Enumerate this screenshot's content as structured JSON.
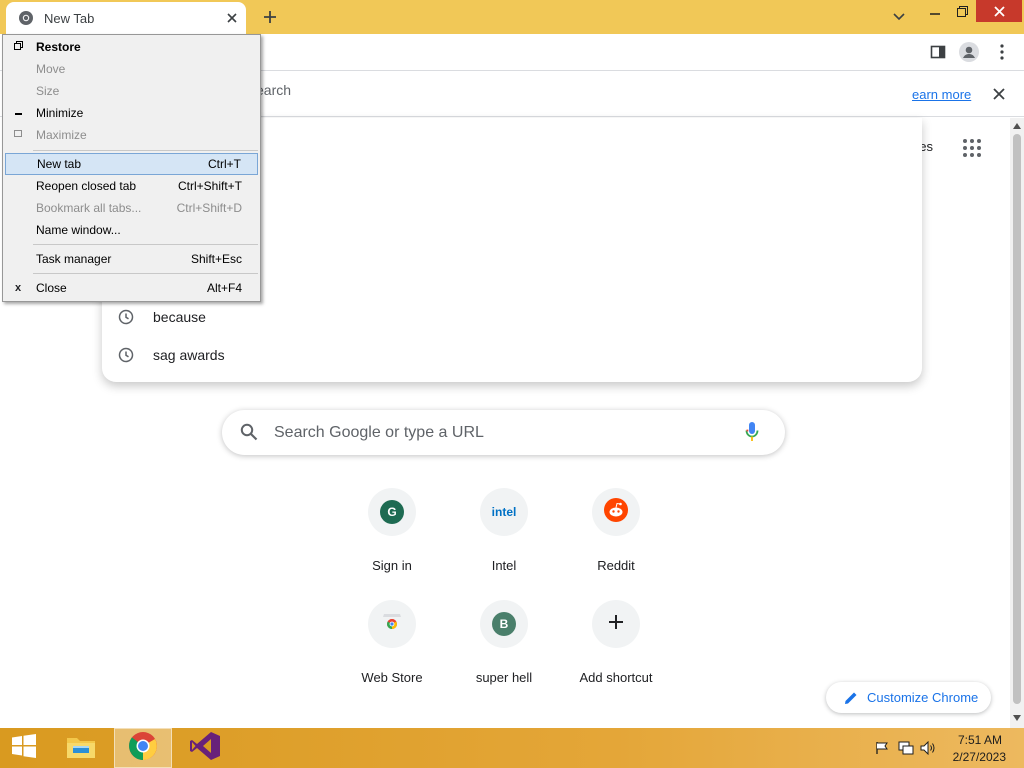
{
  "window": {
    "tab_title": "New Tab"
  },
  "infobar": {
    "text_fragment": "earch",
    "learn_more": "earn more"
  },
  "header": {
    "images_fragment": "ges"
  },
  "suggestions": [
    {
      "text": "because"
    },
    {
      "text": "sag awards"
    }
  ],
  "search": {
    "placeholder": "Search Google or type a URL"
  },
  "shortcuts": [
    {
      "label": "Sign in",
      "badge": "G",
      "color": "#1e6b52"
    },
    {
      "label": "Intel",
      "badge": "intel",
      "color": "#0071c5"
    },
    {
      "label": "Reddit",
      "badge": "",
      "color": "#ff4500"
    },
    {
      "label": "Web Store",
      "badge": "",
      "color": "#4285f4"
    },
    {
      "label": "super hell",
      "badge": "B",
      "color": "#4a7f6b"
    },
    {
      "label": "Add shortcut",
      "badge": "+",
      "color": "#202124"
    }
  ],
  "customize": {
    "label": "Customize Chrome"
  },
  "system_menu": {
    "items": [
      {
        "label": "Restore",
        "accel": "",
        "glyph": "restore-icon"
      },
      {
        "label": "Move",
        "accel": ""
      },
      {
        "label": "Size",
        "accel": ""
      },
      {
        "label": "Minimize",
        "accel": "",
        "glyph": "minimize-icon"
      },
      {
        "label": "Maximize",
        "accel": "",
        "glyph": "maximize-icon"
      },
      {
        "label": "New tab",
        "accel": "Ctrl+T"
      },
      {
        "label": "Reopen closed tab",
        "accel": "Ctrl+Shift+T"
      },
      {
        "label": "Bookmark all tabs...",
        "accel": "Ctrl+Shift+D"
      },
      {
        "label": "Name window...",
        "accel": ""
      },
      {
        "label": "Task manager",
        "accel": "Shift+Esc"
      },
      {
        "label": "Close",
        "accel": "Alt+F4",
        "glyph": "x"
      }
    ]
  },
  "taskbar": {
    "time": "7:51 AM",
    "date": "2/27/2023"
  }
}
